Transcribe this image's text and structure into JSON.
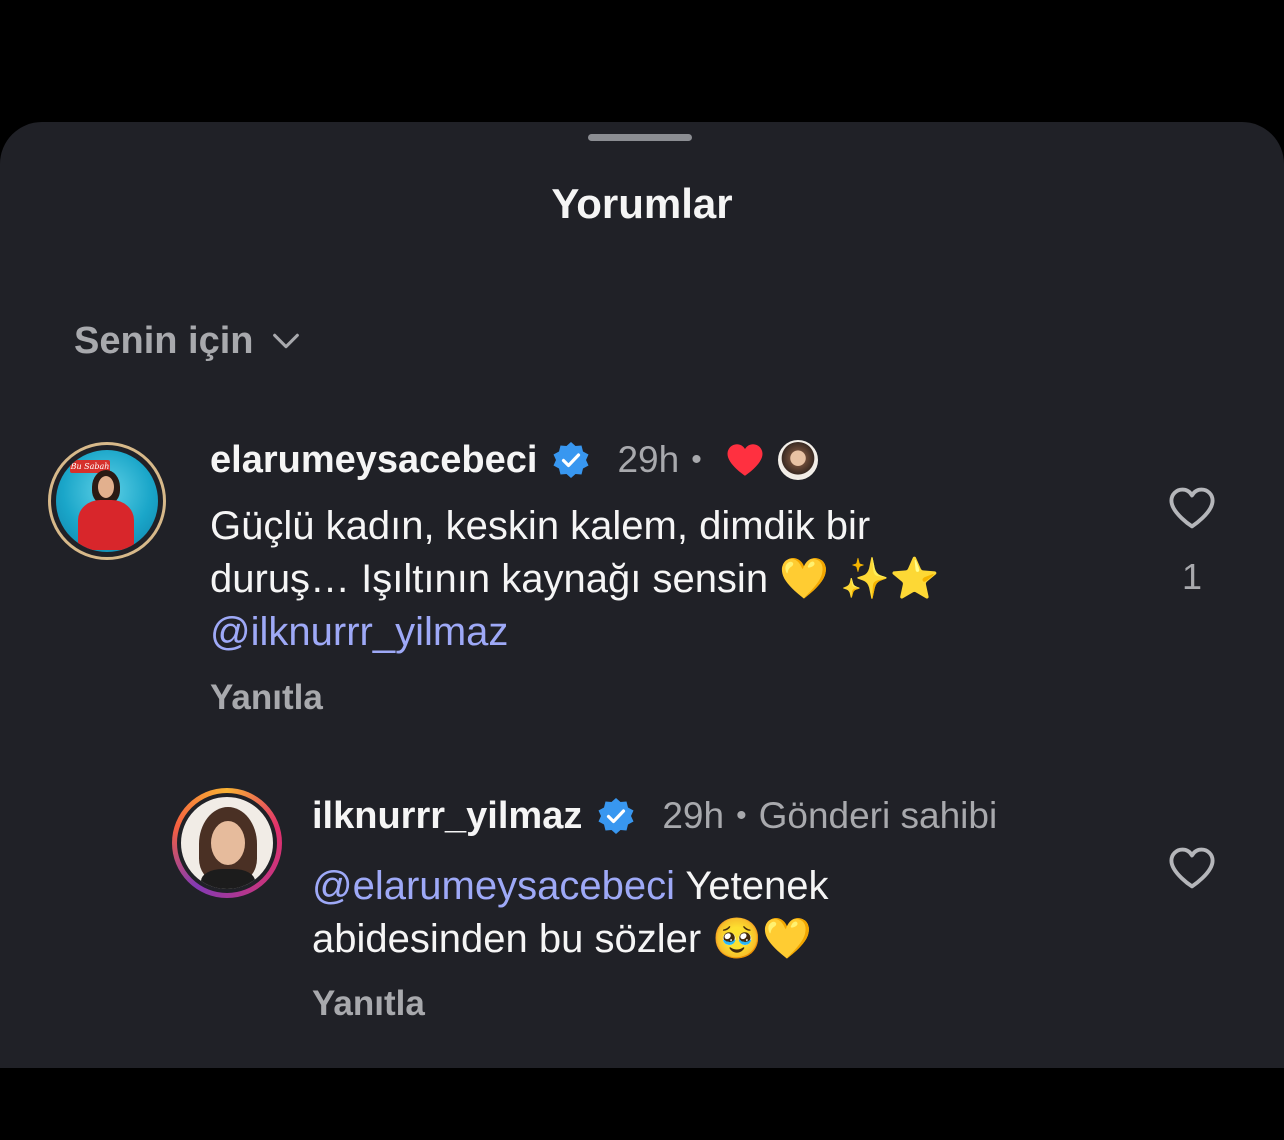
{
  "sheet": {
    "title": "Yorumlar"
  },
  "sort": {
    "label": "Senin için"
  },
  "comments": [
    {
      "username": "elarumeysacebeci",
      "verified": true,
      "time": "29h",
      "separator": "•",
      "liked_by_author": true,
      "text_line1": "Güçlü kadın, keskin kalem, dimdik bir",
      "text_line2": "duruş… Işıltının kaynağı sensin 💛 ✨⭐",
      "mention": "@ilknurrr_yilmaz",
      "reply_label": "Yanıtla",
      "like_count": "1",
      "avatar_badge_text": "Bu Sabah"
    },
    {
      "username": "ilknurrr_yilmaz",
      "verified": true,
      "time": "29h",
      "separator": "•",
      "author_label": "Gönderi sahibi",
      "mention": "@elarumeysacebeci",
      "text_after_mention": " Yetenek",
      "text_line2": "abidesinden bu sözler 🥹💛",
      "reply_label": "Yanıtla"
    }
  ],
  "colors": {
    "sheet_bg": "#202127",
    "mention": "#9ea9f7",
    "verified": "#3897f0",
    "heart_red": "#ff3040"
  }
}
